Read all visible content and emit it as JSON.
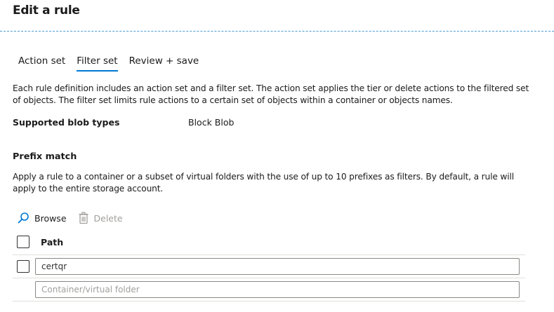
{
  "page": {
    "title": "Edit a rule"
  },
  "tabs": [
    {
      "label": "Action set",
      "active": false
    },
    {
      "label": "Filter set",
      "active": true
    },
    {
      "label": "Review + save",
      "active": false
    }
  ],
  "intro": {
    "description": "Each rule definition includes an action set and a filter set. The action set applies the tier or delete actions to the filtered set of objects. The filter set limits rule actions to a certain set of objects within a container or objects names."
  },
  "blob_types": {
    "label": "Supported blob types",
    "value": "Block Blob"
  },
  "prefix_match": {
    "title": "Prefix match",
    "description": "Apply a rule to a container or a subset of virtual folders with the use of up to 10 prefixes as filters. By default, a rule will apply to the entire storage account."
  },
  "toolbar": {
    "browse_label": "Browse",
    "browse_icon": "search-icon",
    "delete_label": "Delete",
    "delete_icon": "trash-icon",
    "delete_disabled": true
  },
  "grid": {
    "column_path": "Path",
    "rows": [
      {
        "value": "certqr",
        "placeholder": ""
      },
      {
        "value": "",
        "placeholder": "Container/virtual folder"
      }
    ]
  },
  "colors": {
    "accent": "#0078d4",
    "disabled": "#a19f9d"
  }
}
